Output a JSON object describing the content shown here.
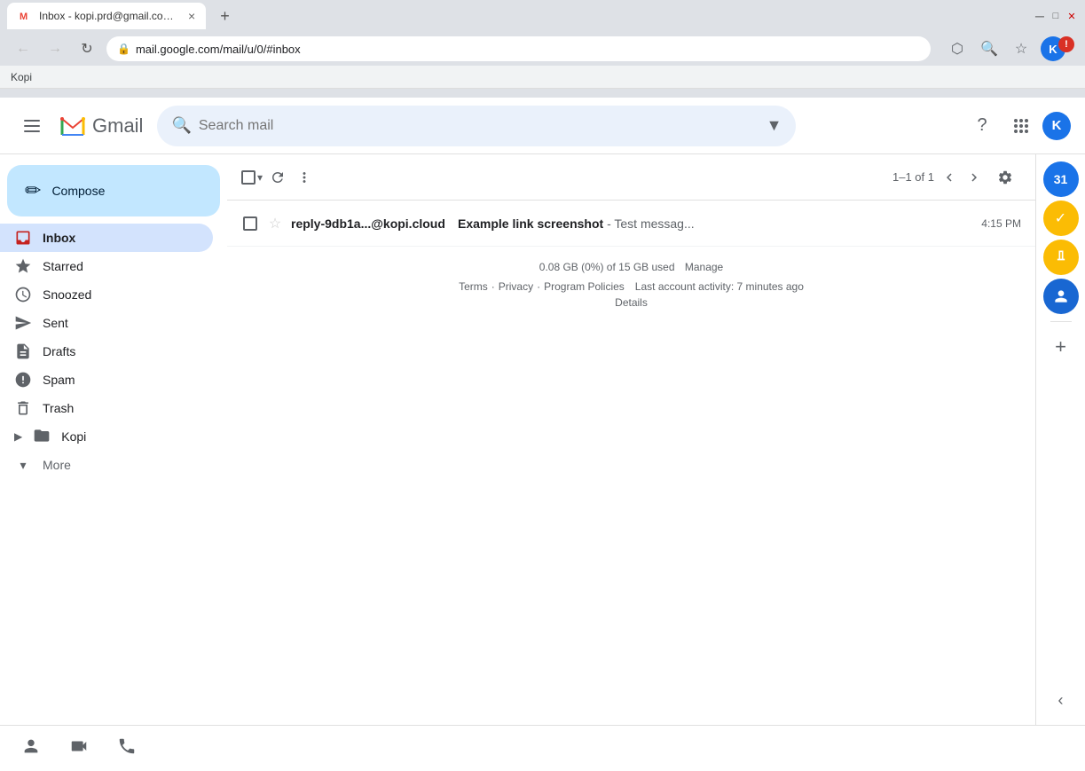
{
  "browser": {
    "tab_title": "Inbox - kopi.prd@gmail.com - G",
    "tab_close": "×",
    "new_tab": "+",
    "url": "mail.google.com/mail/u/0/#inbox",
    "back_disabled": true,
    "forward_disabled": true,
    "bookmark_label": "Kopi"
  },
  "header": {
    "app_name": "Gmail",
    "search_placeholder": "Search mail",
    "avatar_letter": "K"
  },
  "sidebar": {
    "compose_label": "Compose",
    "nav_items": [
      {
        "id": "inbox",
        "label": "Inbox",
        "icon": "inbox",
        "active": true
      },
      {
        "id": "starred",
        "label": "Starred",
        "icon": "star"
      },
      {
        "id": "snoozed",
        "label": "Snoozed",
        "icon": "clock"
      },
      {
        "id": "sent",
        "label": "Sent",
        "icon": "send"
      },
      {
        "id": "drafts",
        "label": "Drafts",
        "icon": "draft"
      },
      {
        "id": "spam",
        "label": "Spam",
        "icon": "warning"
      },
      {
        "id": "trash",
        "label": "Trash",
        "icon": "trash"
      }
    ],
    "kopi_label": "Kopi",
    "more_label": "More"
  },
  "toolbar": {
    "page_info": "1–1 of 1",
    "refresh_title": "Refresh",
    "more_title": "More"
  },
  "emails": [
    {
      "sender": "reply-9db1a...@kopi.cloud",
      "subject": "Example link screenshot",
      "snippet": "- Test messag...",
      "time": "4:15 PM",
      "starred": false,
      "unread": true
    }
  ],
  "footer": {
    "storage": "0.08 GB (0%) of 15 GB used",
    "manage": "Manage",
    "terms": "Terms",
    "privacy": "Privacy",
    "program_policies": "Program Policies",
    "activity": "Last account activity: 7 minutes ago",
    "details": "Details"
  }
}
